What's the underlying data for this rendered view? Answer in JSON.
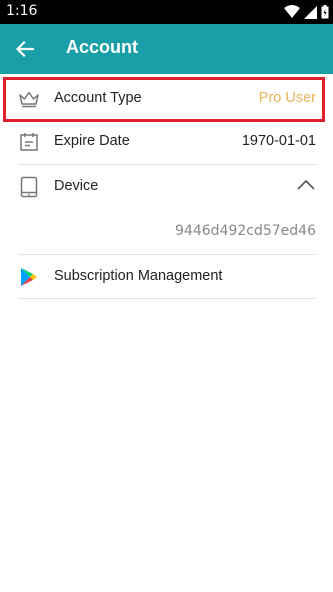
{
  "status_bar": {
    "time": "1:16"
  },
  "app_bar": {
    "title": "Account"
  },
  "rows": {
    "account_type": {
      "label": "Account Type",
      "value": "Pro User"
    },
    "expire_date": {
      "label": "Expire Date",
      "value": "1970-01-01"
    },
    "device": {
      "label": "Device",
      "id": "9446d492cd57ed46"
    },
    "subscription": {
      "label": "Subscription Management"
    }
  },
  "colors": {
    "app_bar": "#1a9ea8",
    "pro_value": "#e8b65b",
    "highlight": "#e0202c"
  },
  "icons": [
    "arrow-back-icon",
    "crown-icon",
    "calendar-icon",
    "tablet-icon",
    "chevron-up-icon",
    "google-play-icon"
  ]
}
